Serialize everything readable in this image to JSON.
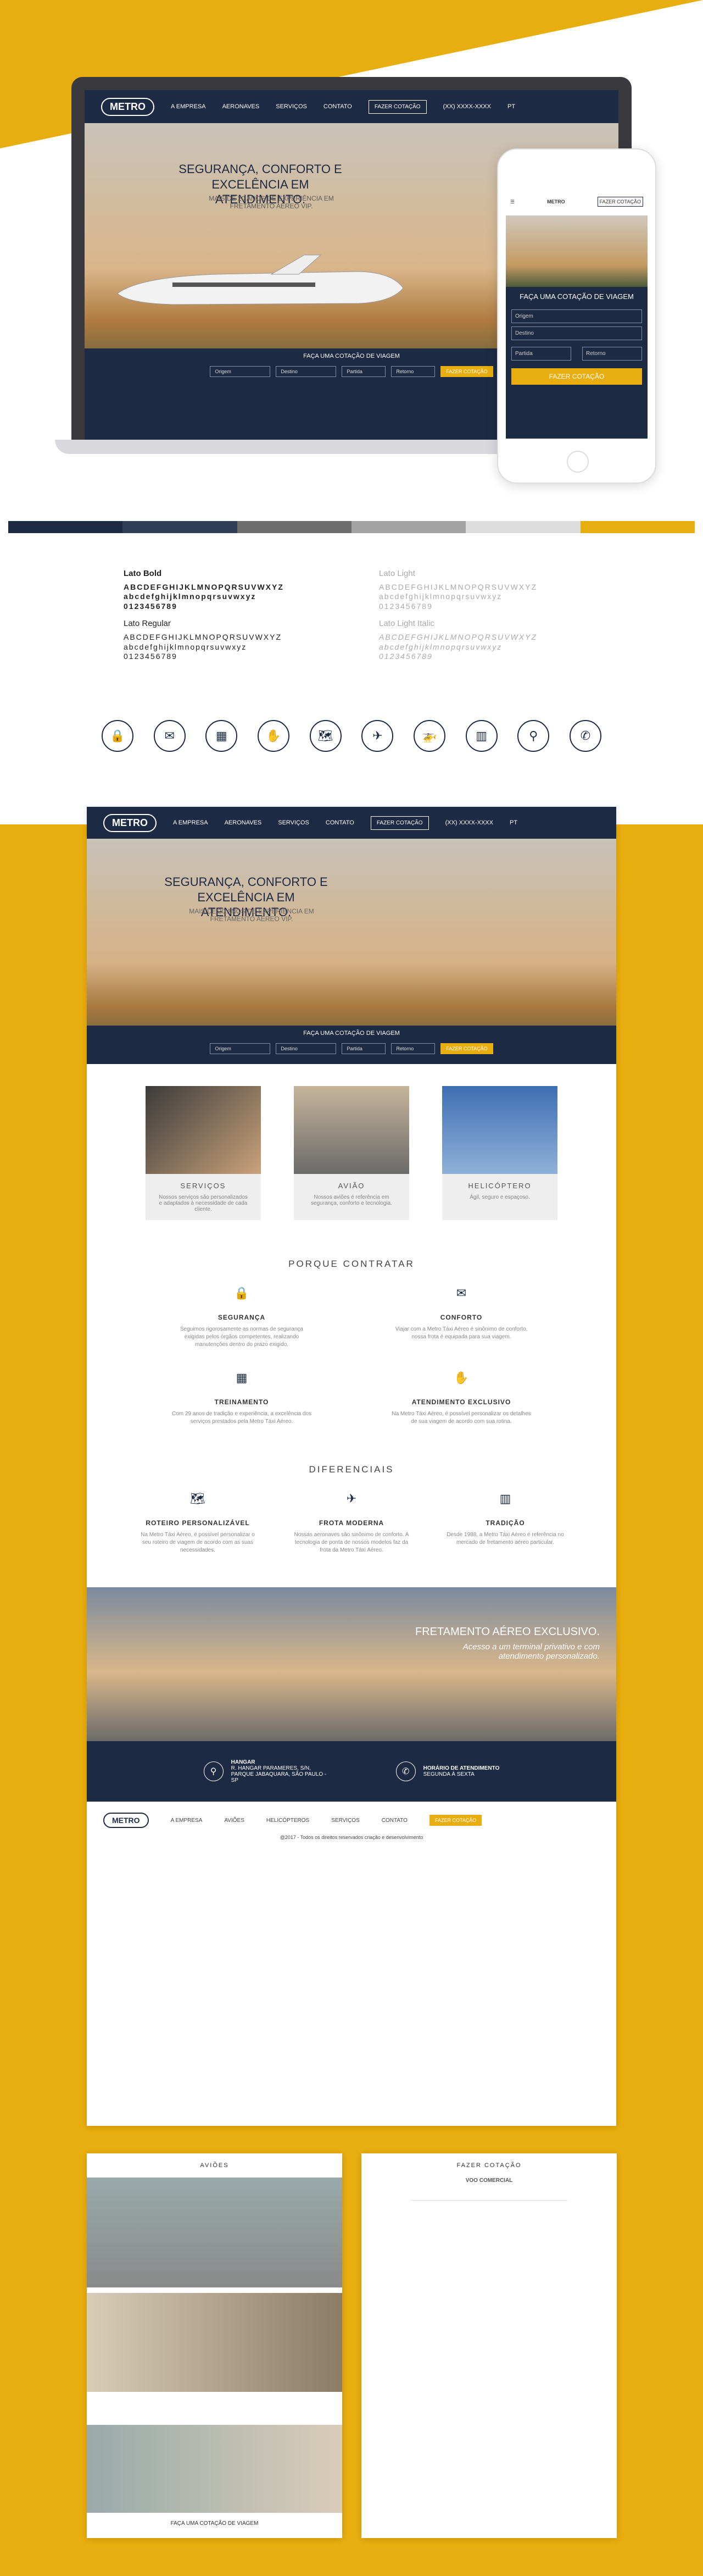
{
  "nav": {
    "logo": "METRO",
    "items": [
      "A EMPRESA",
      "AERONAVES",
      "SERVIÇOS",
      "CONTATO"
    ],
    "quote_button": "FAZER COTAÇÃO",
    "phone": "(XX) XXXX-XXXX",
    "lang": "PT"
  },
  "hero": {
    "title": "SEGURANÇA, CONFORTO E EXCELÊNCIA EM ATENDIMENTO.",
    "subtitle": "MAIS DE 20 ANOS DE EXPERIÊNCIA EM FRETAMENTO AÉREO VIP.",
    "quote_title": "FAÇA UMA COTAÇÃO DE VIAGEM",
    "fields": [
      "Origem",
      "Destino",
      "Partida",
      "Retorno"
    ],
    "submit": "FAZER COTAÇÃO"
  },
  "phone": {
    "quote_title": "FAÇA UMA COTAÇÃO DE VIAGEM",
    "fields": [
      "Origem",
      "Destino",
      "Partida",
      "Retorno"
    ],
    "submit": "FAZER COTAÇÃO",
    "nav_button": "FAZER COTAÇÃO"
  },
  "palette": [
    "#1c2a44",
    "#2f3d57",
    "#6d6d6d",
    "#a3a3a3",
    "#dcdcdc",
    "#e8ad0e"
  ],
  "typography": {
    "bold_name": "Lato Bold",
    "regular_name": "Lato Regular",
    "light_name": "Lato Light",
    "light_italic_name": "Lato Light Italic",
    "upper": "ABCDEFGHIJKLMNOPQRSUVWXYZ",
    "lower": "abcdefghijklmnopqrsuvwxyz",
    "digits": "0123456789"
  },
  "icons": [
    "lock-icon",
    "mail-icon",
    "boxes-icon",
    "hand-plane-icon",
    "map-icon",
    "airplane-icon",
    "helicopter-icon",
    "building-icon",
    "location-pin-icon",
    "phone-icon"
  ],
  "services": [
    {
      "title": "SERVIÇOS",
      "text": "Nossos serviços são personalizados e adaptados à necessidade de cada cliente."
    },
    {
      "title": "AVIÃO",
      "text": "Nossos aviões é referência em segurança, conforto e tecnologia."
    },
    {
      "title": "HELICÓPTERO",
      "text": "Ágil, seguro e espaçoso."
    }
  ],
  "why": {
    "title": "PORQUE CONTRATAR",
    "items": [
      {
        "title": "SEGURANÇA",
        "text": "Seguimos rigorosamente as normas de segurança exigidas pelos órgãos competentes, realizando manutenções dentro do prazo exigido."
      },
      {
        "title": "CONFORTO",
        "text": "Viajar com a Metro Táxi Aéreo é sinônimo de conforto, nossa frota é equipada para sua viagem."
      },
      {
        "title": "TREINAMENTO",
        "text": "Com 29 anos de tradição e experiência, a excelência dos serviços prestados pela Metro Táxi Aéreo."
      },
      {
        "title": "ATENDIMENTO EXCLUSIVO",
        "text": "Na Metro Táxi Aéreo, é possível personalizar os detalhes de sua viagem de acordo com sua rotina."
      }
    ]
  },
  "diff": {
    "title": "DIFERENCIAIS",
    "items": [
      {
        "title": "ROTEIRO PERSONALIZÁVEL",
        "text": "Na Metro Táxi Aéreo, é possível personalizar o seu roteiro de viagem de acordo com as suas necessidades."
      },
      {
        "title": "FROTA MODERNA",
        "text": "Nossas aeronaves são sinônimo de conforto. A tecnologia de ponta de nossos modelos faz da frota da Metro Táxi Aéreo."
      },
      {
        "title": "TRADIÇÃO",
        "text": "Desde 1988, a Metro Táxi Aéreo é referência no mercado de fretamento aéreo particular."
      }
    ]
  },
  "banner": {
    "title": "FRETAMENTO AÉREO EXCLUSIVO.",
    "subtitle": "Acesso a um terminal privativo e com atendimento personalizado."
  },
  "contact": {
    "hangar_title": "HANGAR",
    "hangar_text": "R. HANGAR PARAMERES, S/N, PARQUE JABAQUARA, SÃO PAULO - SP",
    "hours_title": "HORÁRIO DE ATENDIMENTO",
    "hours_text": "SEGUNDA À SEXTA"
  },
  "footer": {
    "items": [
      "A EMPRESA",
      "AVIÕES",
      "HELICÓPTEROS",
      "SERVIÇOS",
      "CONTATO"
    ],
    "button": "FAZER COTAÇÃO",
    "copy": "@2017 - Todos os direitos reservados criação e desenvolvimento"
  },
  "mock_left": {
    "title": "AVIÕES",
    "footer": "FAÇA UMA COTAÇÃO DE VIAGEM"
  },
  "mock_right": {
    "title": "FAZER COTAÇÃO",
    "subtitle": "VOO COMERCIAL"
  }
}
